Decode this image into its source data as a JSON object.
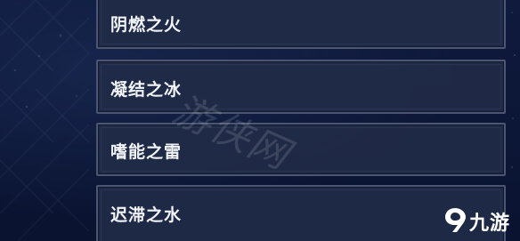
{
  "options": [
    {
      "label": "阴燃之火"
    },
    {
      "label": "凝结之冰"
    },
    {
      "label": "嗜能之雷"
    },
    {
      "label": "迟滞之水"
    }
  ],
  "watermark": {
    "text": "游侠网"
  },
  "brand": {
    "text": "九游",
    "icon": "nine-game-logo-icon"
  },
  "colors": {
    "background": "#0c1636",
    "row_fill": "#212b48",
    "row_border": "#4b5672",
    "label_text": "#f1f3f7"
  }
}
